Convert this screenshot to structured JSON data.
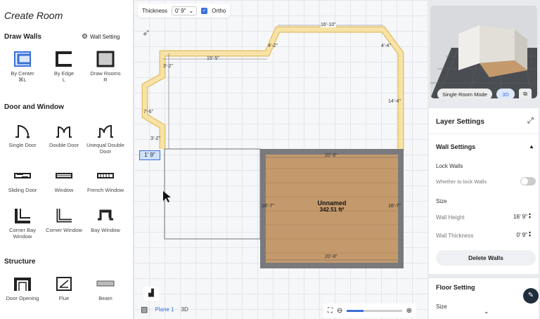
{
  "left_panel": {
    "title": "Create Room",
    "draw_walls": {
      "heading": "Draw Walls",
      "setting_label": "Wall Setting",
      "tools": [
        {
          "label": "By Center",
          "shortcut": "⌘L"
        },
        {
          "label": "By Edge",
          "shortcut": "L"
        },
        {
          "label": "Draw Rooms",
          "shortcut": "R"
        }
      ]
    },
    "door_window": {
      "heading": "Door and Window",
      "tools": [
        {
          "label": "Single Door"
        },
        {
          "label": "Double Door"
        },
        {
          "label": "Unequal Double Door"
        },
        {
          "label": "Sliding Door"
        },
        {
          "label": "Window"
        },
        {
          "label": "French Window"
        },
        {
          "label": "Corner Bay Window"
        },
        {
          "label": "Corner Window"
        },
        {
          "label": "Bay Window"
        }
      ]
    },
    "structure": {
      "heading": "Structure",
      "tools": [
        {
          "label": "Door Opening"
        },
        {
          "label": "Flue"
        },
        {
          "label": "Beam"
        }
      ]
    }
  },
  "toolbar": {
    "thickness_label": "Thickness",
    "thickness_value": "0' 9\"",
    "ortho_label": "Ortho"
  },
  "canvas": {
    "dims": {
      "top": "16'-10\"",
      "upper_left": "15'-5\"",
      "diag_left": "4'-2\"",
      "diag_right": "4'-4\"",
      "right": "14'-4\"",
      "small1": "3'-2\"",
      "left_v": "7'-6\"",
      "small2": "3'-2\"",
      "input": "1' 9\""
    },
    "room": {
      "name": "Unnamed",
      "area": "342.51 ft²",
      "dim_top": "20'-8\"",
      "dim_bottom": "20'-8\"",
      "dim_left": "16'-7\"",
      "dim_right": "16'-7\""
    }
  },
  "bottom_bar": {
    "plane": "Plane 1",
    "view": "3D"
  },
  "preview": {
    "mode_label": "Single Room Mode",
    "view_label": "3D"
  },
  "settings": {
    "layer_title": "Layer Settings",
    "wall_title": "Wall Settings",
    "lock_label": "Lock Walls",
    "lock_desc": "Whether to lock Walls",
    "size_label": "Size",
    "height_label": "Wall Height",
    "height_value": "16' 9\"",
    "thick_label": "Wall Thickness",
    "thick_value": "0' 9\"",
    "delete_label": "Delete Walls",
    "floor_title": "Floor Setting",
    "floor_size": "Size"
  },
  "colors": {
    "accent": "#3a6fd8",
    "wall": "#f5dea0",
    "floor": "#c79a6b",
    "room_wall": "#6f6f73"
  }
}
